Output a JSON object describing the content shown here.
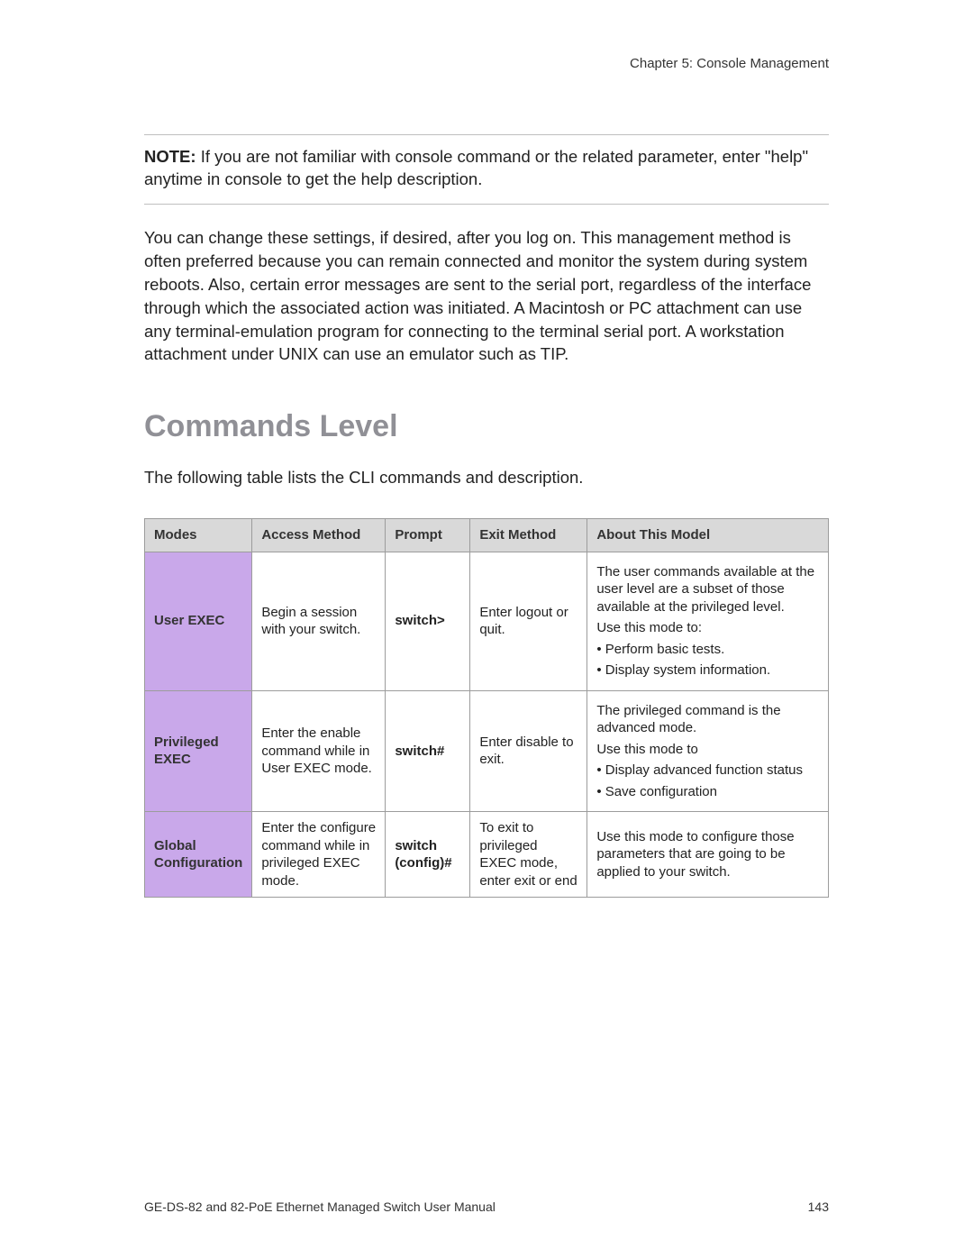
{
  "chapter": "Chapter 5: Console Management",
  "note_label": "NOTE:",
  "note_text": " If you are not familiar with console command or the related parameter, enter \"help\" anytime in console to get the help description.",
  "para1": "You can change these settings, if desired, after you log on. This management method is often preferred because you can remain connected and monitor the system during system reboots. Also, certain error messages are sent to the serial port, regardless of the interface through which the associated action was initiated. A Macintosh or PC attachment can use any terminal-emulation program for connecting to the terminal serial port. A workstation attachment under UNIX can use an emulator such as TIP.",
  "heading": "Commands Level",
  "table_intro": "The following table lists the CLI commands and description.",
  "headers": {
    "modes": "Modes",
    "access": "Access Method",
    "prompt": "Prompt",
    "exit": "Exit Method",
    "about": "About This Model"
  },
  "rows": {
    "r1": {
      "mode": "User EXEC",
      "access": "Begin a session with your switch.",
      "prompt": "switch>",
      "exit": "Enter logout or quit.",
      "about_p1": "The user commands available at the user level are a subset of those available at the privileged level.",
      "about_p2": "Use this mode to:",
      "about_li1": "• Perform basic tests.",
      "about_li2": "• Display system information."
    },
    "r2": {
      "mode": "Privileged EXEC",
      "access": "Enter the enable command while in User EXEC mode.",
      "prompt": "switch#",
      "exit": "Enter disable to exit.",
      "about_p1": "The privileged command is the advanced mode.",
      "about_p2": "Use this mode to",
      "about_li1": "• Display advanced function status",
      "about_li2": "• Save configuration"
    },
    "r3": {
      "mode": "Global Configuration",
      "access": "Enter the configure command while in privileged EXEC mode.",
      "prompt": "switch (config)#",
      "exit": "To exit to privileged EXEC mode, enter exit or end",
      "about_p1": "Use this mode to configure those parameters that are going to be applied to your switch."
    }
  },
  "footer_left": "GE-DS-82 and 82-PoE Ethernet Managed Switch User Manual",
  "footer_right": "143"
}
